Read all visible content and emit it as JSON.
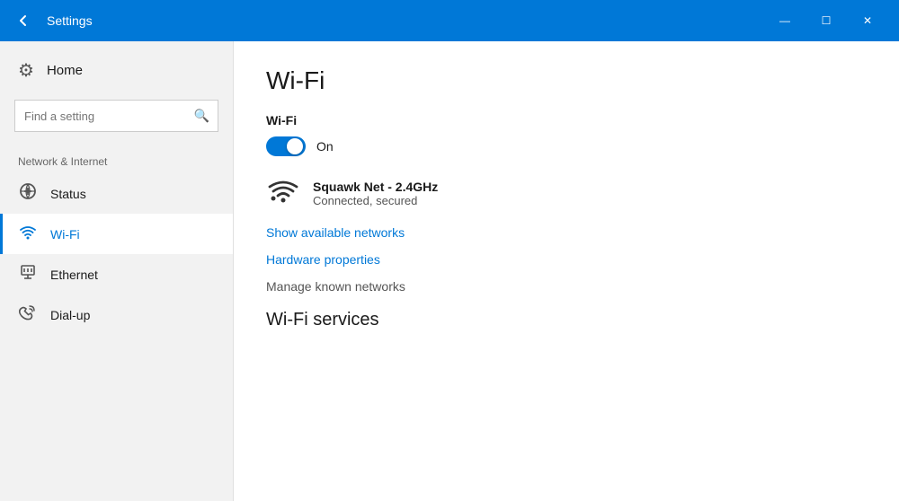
{
  "titlebar": {
    "title": "Settings",
    "back_label": "←",
    "minimize_label": "—",
    "maximize_label": "☐",
    "close_label": "✕"
  },
  "sidebar": {
    "home_label": "Home",
    "search_placeholder": "Find a setting",
    "section_label": "Network & Internet",
    "items": [
      {
        "id": "status",
        "label": "Status",
        "icon": "status"
      },
      {
        "id": "wifi",
        "label": "Wi-Fi",
        "icon": "wifi",
        "active": true
      },
      {
        "id": "ethernet",
        "label": "Ethernet",
        "icon": "ethernet"
      },
      {
        "id": "dialup",
        "label": "Dial-up",
        "icon": "dialup"
      }
    ]
  },
  "content": {
    "page_title": "Wi-Fi",
    "wifi_section_label": "Wi-Fi",
    "toggle_state": "On",
    "network_name": "Squawk Net - 2.4GHz",
    "network_status": "Connected, secured",
    "show_networks_link": "Show available networks",
    "hardware_properties_link": "Hardware properties",
    "manage_networks_link": "Manage known networks",
    "services_title": "Wi-Fi services"
  }
}
